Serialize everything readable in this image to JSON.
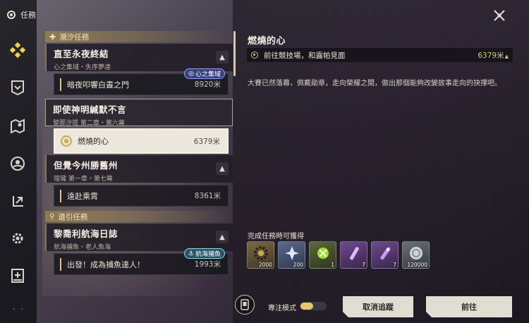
{
  "window": {
    "title": "任務"
  },
  "list": {
    "section1": "潮汐任務",
    "groups": [
      {
        "title": "直至永夜終結",
        "subtitle": "心之集域・失序夢達",
        "items": [
          {
            "label": "暗夜叩響白晝之門",
            "distance": "8920米",
            "tag": "心之集域"
          }
        ]
      },
      {
        "title": "即使神明緘默不言",
        "subtitle": "黎那汐塔 第二章・第六幕",
        "items": [
          {
            "label": "燃燒的心",
            "distance": "6379米"
          }
        ]
      },
      {
        "title": "但覺今州勝舊州",
        "subtitle": "瑝瓏 第一章・第七幕",
        "items": [
          {
            "label": "遠赴乘霄",
            "distance": "8361米"
          }
        ]
      }
    ],
    "section2": "遺引任務",
    "groups2": [
      {
        "title": "黎喬利航海日誌",
        "subtitle": "航海捕魚・老人魚海",
        "items": [
          {
            "label": "出發！成為捕魚達人！",
            "distance": "1993米",
            "tag": "航海捕魚"
          }
        ]
      }
    ]
  },
  "detail": {
    "title": "燃燒的心",
    "objective": "前往競技場，和露帕見面",
    "distance": "6379米",
    "description": "大賽已然落幕，佩戴勛章，走向榮耀之間，做出那個能夠改變故事走向的抉擇吧。",
    "rewards_title": "完成任務時可獲得",
    "rewards": [
      {
        "name": "gear-coin",
        "count": "2000",
        "color": "gold"
      },
      {
        "name": "crystal-shard",
        "count": "200",
        "color": "blue"
      },
      {
        "name": "green-gem",
        "count": "1",
        "color": "green"
      },
      {
        "name": "purple-tube",
        "count": "7",
        "color": "purple"
      },
      {
        "name": "purple-vial",
        "count": "7",
        "color": "purple"
      },
      {
        "name": "silver-coin",
        "count": "120000",
        "color": "gray"
      }
    ]
  },
  "footer": {
    "focus_mode": "專注模式",
    "focus_fill": 0.5,
    "cancel": "取消追蹤",
    "go": "前往"
  },
  "rail_dots": ". ."
}
